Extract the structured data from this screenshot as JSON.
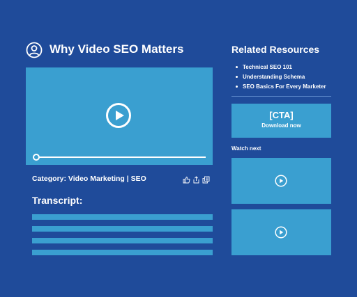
{
  "header": {
    "title": "Why Video SEO Matters",
    "user_icon": "user-circle-icon"
  },
  "video": {
    "play_icon": "play-circle-icon",
    "progress": 0.0
  },
  "category": {
    "text": "Category: Video Marketing | SEO"
  },
  "share_icons": [
    "thumbs-up-icon",
    "share-icon",
    "copy-icon"
  ],
  "transcript": {
    "title": "Transcript:",
    "line_count": 4
  },
  "sidebar": {
    "related_title": "Related Resources",
    "related_items": [
      {
        "label": "Technical SEO 101"
      },
      {
        "label": "Understanding Schema"
      },
      {
        "label": "SEO Basics For Every Marketer"
      }
    ],
    "cta": {
      "title": "[CTA]",
      "subtitle": "Download now"
    },
    "watch_next_label": "Watch next"
  },
  "colors": {
    "background": "#1f4b9a",
    "panel": "#3a9fd0",
    "text": "#ffffff"
  }
}
